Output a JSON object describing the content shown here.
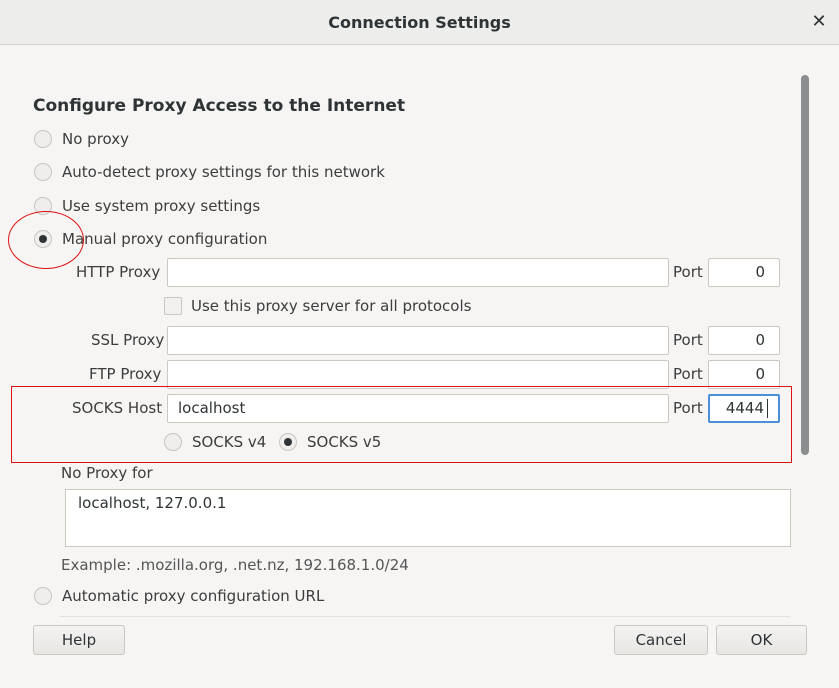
{
  "window": {
    "title": "Connection Settings",
    "close_glyph": "✕"
  },
  "heading": "Configure Proxy Access to the Internet",
  "options": {
    "no_proxy": "No proxy",
    "auto_detect": "Auto-detect proxy settings for this network",
    "system": "Use system proxy settings",
    "manual": "Manual proxy configuration",
    "auto_url": "Automatic proxy configuration URL"
  },
  "selected_option": "manual",
  "http": {
    "label": "HTTP Proxy",
    "value": "",
    "port_label": "Port",
    "port": "0"
  },
  "use_all": "Use this proxy server for all protocols",
  "ssl": {
    "label": "SSL Proxy",
    "value": "",
    "port_label": "Port",
    "port": "0"
  },
  "ftp": {
    "label": "FTP Proxy",
    "value": "",
    "port_label": "Port",
    "port": "0"
  },
  "socks": {
    "label": "SOCKS Host",
    "value": "localhost",
    "port_label": "Port",
    "port": "4444",
    "v4": "SOCKS v4",
    "v5": "SOCKS v5",
    "selected_version": "v5"
  },
  "no_proxy_for": {
    "label": "No Proxy for",
    "value": "localhost, 127.0.0.1"
  },
  "example": "Example: .mozilla.org, .net.nz, 192.168.1.0/24",
  "buttons": {
    "help": "Help",
    "cancel": "Cancel",
    "ok": "OK"
  },
  "colors": {
    "annotation": "#dd1111",
    "focus": "#4a90d9"
  }
}
